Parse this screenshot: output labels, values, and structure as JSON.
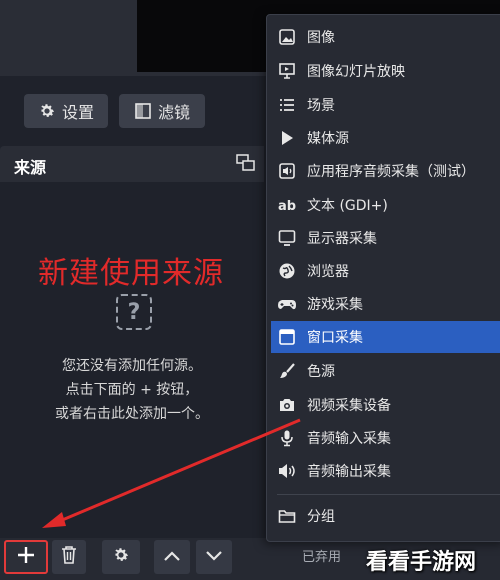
{
  "toolbar": {
    "settings_label": "设置",
    "filters_label": "滤镜"
  },
  "sources_dock": {
    "title": "来源",
    "annotation": "新建使用来源",
    "empty_hint": [
      "您还没有添加任何源。",
      "点击下面的 + 按钮，",
      "或者右击此处添加一个。"
    ]
  },
  "context_menu": {
    "items": [
      {
        "label": "图像",
        "icon": "image-icon"
      },
      {
        "label": "图像幻灯片放映",
        "icon": "slideshow-icon"
      },
      {
        "label": "场景",
        "icon": "list-icon"
      },
      {
        "label": "媒体源",
        "icon": "play-icon"
      },
      {
        "label": "应用程序音频采集（测试）",
        "icon": "app-audio-icon"
      },
      {
        "label": "文本 (GDI+)",
        "icon": "text-icon"
      },
      {
        "label": "显示器采集",
        "icon": "monitor-icon"
      },
      {
        "label": "浏览器",
        "icon": "globe-icon"
      },
      {
        "label": "游戏采集",
        "icon": "gamepad-icon"
      },
      {
        "label": "窗口采集",
        "icon": "window-icon",
        "selected": true
      },
      {
        "label": "色源",
        "icon": "brush-icon"
      },
      {
        "label": "视频采集设备",
        "icon": "camera-icon"
      },
      {
        "label": "音频输入采集",
        "icon": "microphone-icon"
      },
      {
        "label": "音频输出采集",
        "icon": "speaker-icon"
      },
      {
        "label": "分组",
        "icon": "folder-icon"
      }
    ],
    "selected_color": "#2b5fc1"
  },
  "bottom_bar": {
    "disabled_label": "已弃用"
  },
  "watermark": "看看手游网",
  "colors": {
    "background": "#1f222b",
    "annotation_red": "#e12a2a",
    "accent_blue": "#2b5fc1"
  }
}
